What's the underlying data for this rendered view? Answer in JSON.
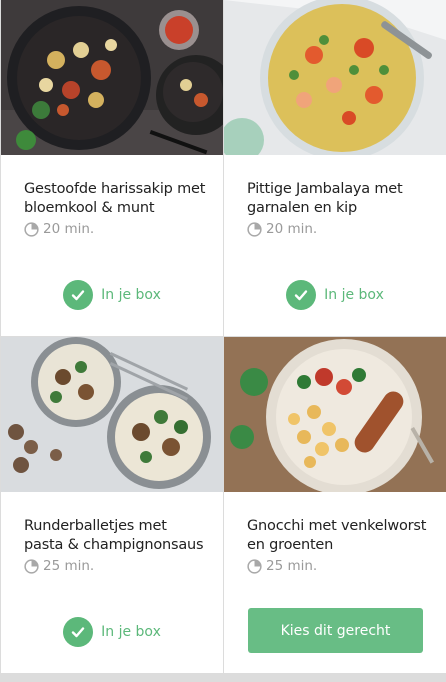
{
  "recipes": [
    {
      "title": "Gestoofde harissakip met bloemkool & munt",
      "time": "20 min.",
      "status": "In je box",
      "image": "harissa-chicken-photo"
    },
    {
      "title": "Pittige Jambalaya met garnalen en kip",
      "time": "20 min.",
      "status": "In je box",
      "image": "jambalaya-photo"
    },
    {
      "title": "Runderballetjes met pasta & champignonsaus",
      "time": "25 min.",
      "status": "In je box",
      "image": "meatballs-pasta-photo"
    },
    {
      "title": "Gnocchi met venkelworst en groenten",
      "time": "25 min.",
      "cta": "Kies dit gerecht",
      "image": "gnocchi-sausage-photo"
    }
  ],
  "icons": {
    "time": "clock-icon",
    "selected": "checkmark-icon"
  },
  "colors": {
    "accent_green": "#5cb87a",
    "cta_green": "#68bd85",
    "muted_text": "#9a9a9a"
  }
}
